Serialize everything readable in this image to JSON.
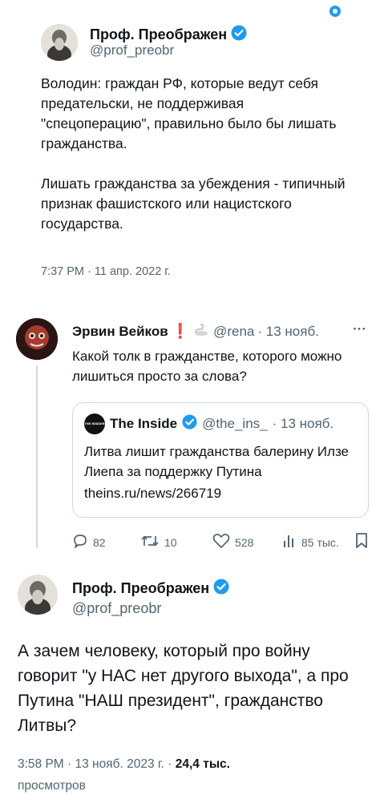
{
  "original": {
    "author_name": "Проф. Преображен",
    "author_handle": "@prof_preobr",
    "text": "Володин: граждан РФ, которые ведут себя предательски, не поддерживая \"спецоперацию\", правильно было бы лишать гражданства.\n\nЛишать гражданства за убеждения - типичный признак фашистского или нацистского государства.",
    "timestamp": "7:37 PM · 11 апр. 2022 г."
  },
  "reply": {
    "author_name": "Эрвин Вейков",
    "emoji_mark": "❗",
    "author_handle": "@rena",
    "date": "· 13 нояб.",
    "more": "···",
    "text": "Какой толк в гражданстве, которого можно лишиться просто за слова?",
    "quote": {
      "avatar_label": "THE INSIDER",
      "name": "The Inside",
      "handle": "@the_ins_",
      "date": "· 13 нояб.",
      "text": "Литва лишит гражданства балерину Илзе Лиепа за поддержку Путина",
      "link": "theins.ru/news/266719"
    },
    "actions": {
      "replies": "82",
      "retweets": "10",
      "likes": "528",
      "views": "85 тыс."
    }
  },
  "main": {
    "author_name": "Проф. Преображен",
    "author_handle": "@prof_preobr",
    "text": "А зачем человеку, который про войну говорит \"у НАС нет другого выхода\", а про Путина \"НАШ президент\", гражданство Литвы?",
    "timestamp": "3:58 PM · 13 нояб. 2023 г. ·",
    "views_count": "24,4 тыс.",
    "views_label": "просмотров"
  },
  "colors": {
    "verified": "#1d9bf0",
    "text": "#0f1419",
    "secondary": "#536471",
    "border": "#cfd9de"
  }
}
